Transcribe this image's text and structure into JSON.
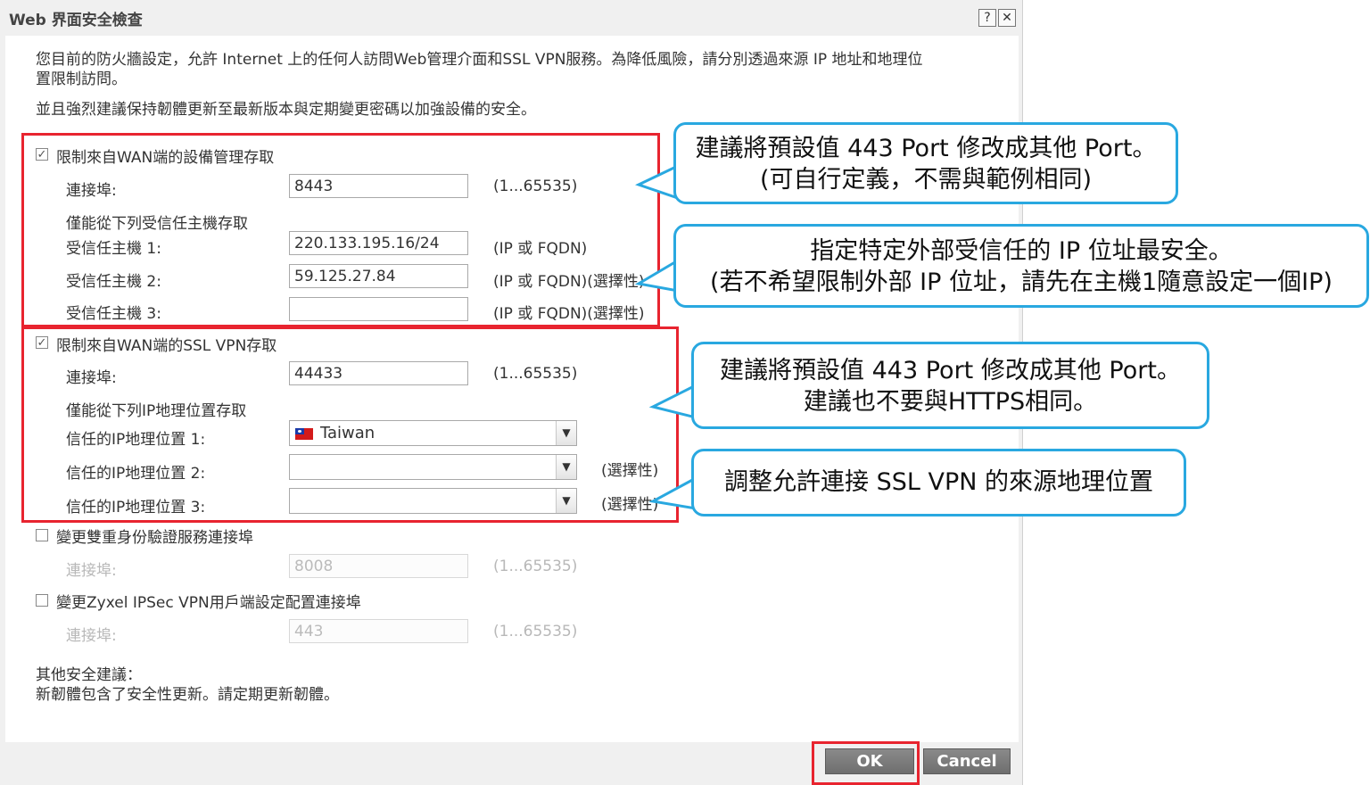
{
  "dialog": {
    "title": "Web 界面安全檢查",
    "help_label": "?",
    "close_label": "✕"
  },
  "intro": {
    "line1": "您目前的防火牆設定，允許 Internet 上的任何人訪問Web管理介面和SSL VPN服務。為降低風險，請分別透過來源 IP 地址和地理位",
    "line2": "置限制訪問。",
    "line3": "並且強烈建議保持韌體更新至最新版本與定期變更密碼以加強設備的安全。"
  },
  "wan_mgmt": {
    "checked": true,
    "label": "限制來自WAN端的設備管理存取",
    "port_label": "連接埠:",
    "port_value": "8443",
    "port_range": "(1...65535)",
    "trusted_heading": "僅能從下列受信任主機存取",
    "hosts": [
      {
        "label": "受信任主機 1:",
        "value": "220.133.195.16/24",
        "hint": "(IP 或 FQDN)"
      },
      {
        "label": "受信任主機 2:",
        "value": "59.125.27.84",
        "hint": "(IP 或 FQDN)(選擇性)"
      },
      {
        "label": "受信任主機 3:",
        "value": "",
        "hint": "(IP 或 FQDN)(選擇性)"
      }
    ]
  },
  "ssl_vpn": {
    "checked": true,
    "label": "限制來自WAN端的SSL VPN存取",
    "port_label": "連接埠:",
    "port_value": "44433",
    "port_range": "(1...65535)",
    "geo_heading": "僅能從下列IP地理位置存取",
    "geos": [
      {
        "label": "信任的IP地理位置 1:",
        "value": "Taiwan",
        "hint": ""
      },
      {
        "label": "信任的IP地理位置 2:",
        "value": "",
        "hint": "(選擇性)"
      },
      {
        "label": "信任的IP地理位置 3:",
        "value": "",
        "hint": "(選擇性)"
      }
    ]
  },
  "two_factor": {
    "checked": false,
    "label": "變更雙重身份驗證服務連接埠",
    "port_label": "連接埠:",
    "port_value": "8008",
    "port_range": "(1...65535)"
  },
  "ipsec": {
    "checked": false,
    "label": "變更Zyxel IPSec VPN用戶端設定配置連接埠",
    "port_label": "連接埠:",
    "port_value": "443",
    "port_range": "(1...65535)"
  },
  "other": {
    "heading": "其他安全建議：",
    "text": "新韌體包含了安全性更新。請定期更新韌體。"
  },
  "buttons": {
    "ok": "OK",
    "cancel": "Cancel"
  },
  "callouts": [
    {
      "line1": "建議將預設值 443 Port 修改成其他 Port。",
      "line2": "(可自行定義，不需與範例相同)"
    },
    {
      "line1": "指定特定外部受信任的 IP 位址最安全。",
      "line2": "(若不希望限制外部 IP 位址，請先在主機1隨意設定一個IP)"
    },
    {
      "line1": "建議將預設值 443 Port 修改成其他 Port。",
      "line2": "建議也不要與HTTPS相同。"
    },
    {
      "line1": "調整允許連接 SSL VPN 的來源地理位置",
      "line2": ""
    }
  ],
  "colors": {
    "highlight_border": "#e8242f",
    "callout_border": "#29a8e0",
    "button_bg": "#7a7a7a"
  },
  "icons": {
    "flag": "taiwan-flag-icon",
    "dropdown": "chevron-down-icon",
    "check": "checkmark-icon"
  }
}
